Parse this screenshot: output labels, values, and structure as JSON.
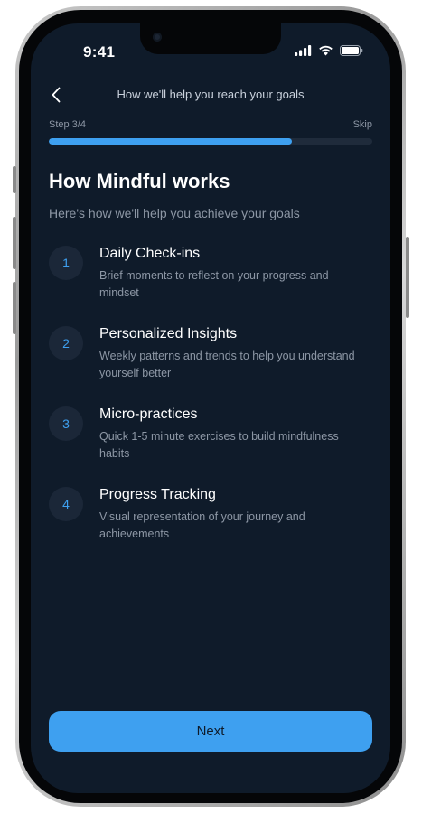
{
  "status_bar": {
    "time": "9:41"
  },
  "header": {
    "title": "How we'll help you reach your goals"
  },
  "progress": {
    "step_label": "Step 3/4",
    "skip_label": "Skip",
    "fraction": 0.75
  },
  "intro": {
    "title": "How Mindful works",
    "subtitle": "Here's how we'll help you achieve your goals"
  },
  "features": [
    {
      "number": "1",
      "title": "Daily Check-ins",
      "description": "Brief moments to reflect on your progress and mindset"
    },
    {
      "number": "2",
      "title": "Personalized Insights",
      "description": "Weekly patterns and trends to help you understand yourself better"
    },
    {
      "number": "3",
      "title": "Micro-practices",
      "description": "Quick 1-5 minute exercises to build mindfulness habits"
    },
    {
      "number": "4",
      "title": "Progress Tracking",
      "description": "Visual representation of your journey and achievements"
    }
  ],
  "footer": {
    "next_label": "Next"
  },
  "colors": {
    "background": "#0f1b2a",
    "accent": "#3ea0f0",
    "muted_text": "#8d97a5"
  },
  "icons": {
    "back": "chevron-left-icon",
    "signal": "cellular-signal-icon",
    "wifi": "wifi-icon",
    "battery": "battery-icon"
  }
}
